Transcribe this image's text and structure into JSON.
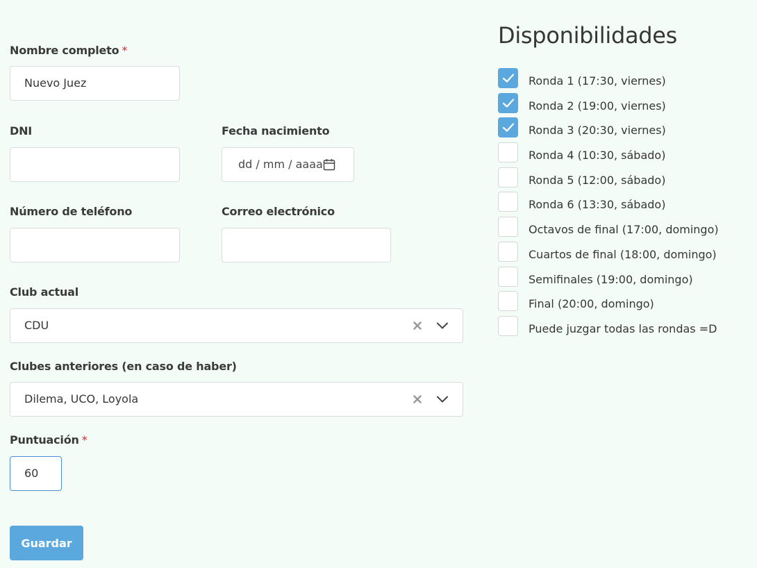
{
  "form": {
    "nombre": {
      "label": "Nombre completo",
      "required": "*",
      "value": "Nuevo Juez"
    },
    "dni": {
      "label": "DNI",
      "value": ""
    },
    "fecha": {
      "label": "Fecha nacimiento",
      "placeholder": "dd / mm / aaaa"
    },
    "telefono": {
      "label": "Número de teléfono",
      "value": ""
    },
    "correo": {
      "label": "Correo electrónico",
      "value": ""
    },
    "club_actual": {
      "label": "Club actual",
      "value": "CDU"
    },
    "clubes_anteriores": {
      "label": "Clubes anteriores (en caso de haber)",
      "value": "Dilema, UCO, Loyola"
    },
    "puntuacion": {
      "label": "Puntuación",
      "required": "*",
      "value": "60"
    },
    "save_label": "Guardar"
  },
  "availability": {
    "title": "Disponibilidades",
    "items": [
      {
        "label": "Ronda 1 (17:30, viernes)",
        "checked": true
      },
      {
        "label": "Ronda 2 (19:00, viernes)",
        "checked": true
      },
      {
        "label": "Ronda 3 (20:30, viernes)",
        "checked": true
      },
      {
        "label": "Ronda 4 (10:30, sábado)",
        "checked": false
      },
      {
        "label": "Ronda 5 (12:00, sábado)",
        "checked": false
      },
      {
        "label": "Ronda 6 (13:30, sábado)",
        "checked": false
      },
      {
        "label": "Octavos de final (17:00, domingo)",
        "checked": false
      },
      {
        "label": "Cuartos de final (18:00, domingo)",
        "checked": false
      },
      {
        "label": "Semifinales (19:00, domingo)",
        "checked": false
      },
      {
        "label": "Final (20:00, domingo)",
        "checked": false
      },
      {
        "label": "Puede juzgar todas las rondas =D",
        "checked": false
      }
    ]
  },
  "colors": {
    "background": "#f3fcf7",
    "accent": "#5ba8df",
    "required": "#e0202a"
  },
  "icons": {
    "date": "calendar-icon",
    "clear": "clear-x-icon",
    "dropdown": "chevron-down-icon",
    "check": "check-icon"
  }
}
